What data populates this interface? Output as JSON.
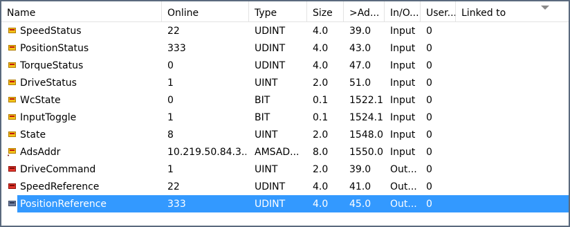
{
  "columns": [
    "Name",
    "Online",
    "Type",
    "Size",
    ">Ad...",
    "In/O...",
    "User...",
    "Linked to"
  ],
  "rows": [
    {
      "icon": "input-variable-icon",
      "name": "SpeedStatus",
      "online": "22",
      "type": "UDINT",
      "size": "4.0",
      "addr": "39.0",
      "io": "Input",
      "user": "0",
      "linked": ""
    },
    {
      "icon": "input-variable-icon",
      "name": "PositionStatus",
      "online": "333",
      "type": "UDINT",
      "size": "4.0",
      "addr": "43.0",
      "io": "Input",
      "user": "0",
      "linked": ""
    },
    {
      "icon": "input-variable-icon",
      "name": "TorqueStatus",
      "online": "0",
      "type": "UDINT",
      "size": "4.0",
      "addr": "47.0",
      "io": "Input",
      "user": "0",
      "linked": ""
    },
    {
      "icon": "input-variable-icon",
      "name": "DriveStatus",
      "online": "1",
      "type": "UINT",
      "size": "2.0",
      "addr": "51.0",
      "io": "Input",
      "user": "0",
      "linked": ""
    },
    {
      "icon": "input-variable-icon",
      "name": "WcState",
      "online": "0",
      "type": "BIT",
      "size": "0.1",
      "addr": "1522.1",
      "io": "Input",
      "user": "0",
      "linked": ""
    },
    {
      "icon": "input-variable-icon",
      "name": "InputToggle",
      "online": "1",
      "type": "BIT",
      "size": "0.1",
      "addr": "1524.1",
      "io": "Input",
      "user": "0",
      "linked": ""
    },
    {
      "icon": "input-variable-icon",
      "name": "State",
      "online": "8",
      "type": "UINT",
      "size": "2.0",
      "addr": "1548.0",
      "io": "Input",
      "user": "0",
      "linked": ""
    },
    {
      "icon": "ads-address-icon",
      "name": "AdsAddr",
      "online": "10.219.50.84.3....",
      "type": "AMSAD...",
      "size": "8.0",
      "addr": "1550.0",
      "io": "Input",
      "user": "0",
      "linked": ""
    },
    {
      "icon": "output-variable-icon",
      "name": "DriveCommand",
      "online": "1",
      "type": "UINT",
      "size": "2.0",
      "addr": "39.0",
      "io": "Out...",
      "user": "0",
      "linked": ""
    },
    {
      "icon": "output-variable-icon",
      "name": "SpeedReference",
      "online": "22",
      "type": "UDINT",
      "size": "4.0",
      "addr": "41.0",
      "io": "Out...",
      "user": "0",
      "linked": ""
    },
    {
      "icon": "output-variable-icon",
      "name": "PositionReference",
      "online": "333",
      "type": "UDINT",
      "size": "4.0",
      "addr": "45.0",
      "io": "Out...",
      "user": "0",
      "linked": "",
      "selected": true
    }
  ],
  "colors": {
    "selection": "#3399ff",
    "border": "#5a6a7e",
    "input_icon": "#f3c21a",
    "output_icon": "#e2342a"
  }
}
